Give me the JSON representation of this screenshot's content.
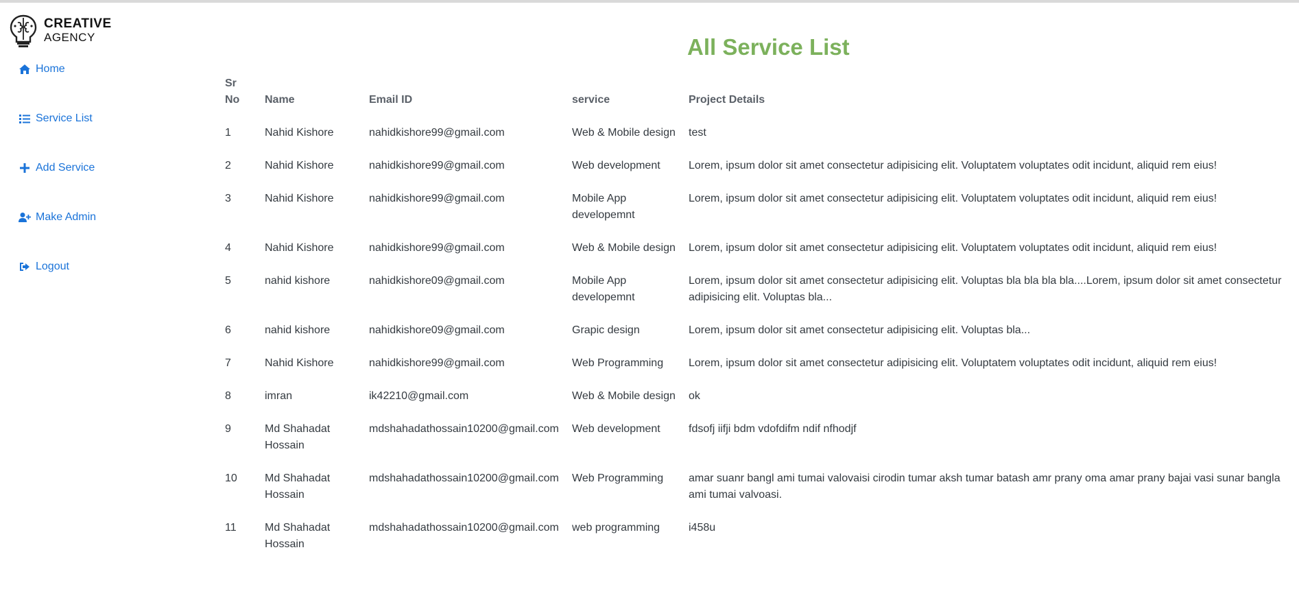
{
  "brand": {
    "line1": "CREATIVE",
    "line2": "AGENCY"
  },
  "sidebar": {
    "items": [
      {
        "label": "Home",
        "icon": "home-icon"
      },
      {
        "label": "Service List",
        "icon": "list-icon"
      },
      {
        "label": "Add Service",
        "icon": "plus-icon"
      },
      {
        "label": "Make Admin",
        "icon": "user-plus-icon"
      },
      {
        "label": "Logout",
        "icon": "logout-icon"
      }
    ]
  },
  "page": {
    "title": "All Service List"
  },
  "table": {
    "headers": {
      "sr": "Sr No",
      "name": "Name",
      "email": "Email ID",
      "service": "service",
      "details": "Project Details"
    },
    "rows": [
      {
        "sr": "1",
        "name": "Nahid Kishore",
        "email": "nahidkishore99@gmail.com",
        "service": "Web & Mobile design",
        "details": "test"
      },
      {
        "sr": "2",
        "name": "Nahid Kishore",
        "email": "nahidkishore99@gmail.com",
        "service": "Web development",
        "details": "Lorem, ipsum dolor sit amet consectetur adipisicing elit. Voluptatem voluptates odit incidunt, aliquid rem eius!"
      },
      {
        "sr": "3",
        "name": "Nahid Kishore",
        "email": "nahidkishore99@gmail.com",
        "service": "Mobile App developemnt",
        "details": "Lorem, ipsum dolor sit amet consectetur adipisicing elit. Voluptatem voluptates odit incidunt, aliquid rem eius!"
      },
      {
        "sr": "4",
        "name": "Nahid Kishore",
        "email": "nahidkishore99@gmail.com",
        "service": "Web & Mobile design",
        "details": "Lorem, ipsum dolor sit amet consectetur adipisicing elit. Voluptatem voluptates odit incidunt, aliquid rem eius!"
      },
      {
        "sr": "5",
        "name": "nahid kishore",
        "email": "nahidkishore09@gmail.com",
        "service": "Mobile App developemnt",
        "details": "Lorem, ipsum dolor sit amet consectetur adipisicing elit. Voluptas bla bla bla bla....Lorem, ipsum dolor sit amet consectetur adipisicing elit. Voluptas bla..."
      },
      {
        "sr": "6",
        "name": "nahid kishore",
        "email": "nahidkishore09@gmail.com",
        "service": "Grapic design",
        "details": "Lorem, ipsum dolor sit amet consectetur adipisicing elit. Voluptas bla..."
      },
      {
        "sr": "7",
        "name": "Nahid Kishore",
        "email": "nahidkishore99@gmail.com",
        "service": "Web Programming",
        "details": "Lorem, ipsum dolor sit amet consectetur adipisicing elit. Voluptatem voluptates odit incidunt, aliquid rem eius!"
      },
      {
        "sr": "8",
        "name": "imran",
        "email": "ik42210@gmail.com",
        "service": "Web & Mobile design",
        "details": "ok"
      },
      {
        "sr": "9",
        "name": "Md Shahadat Hossain",
        "email": "mdshahadathossain10200@gmail.com",
        "service": "Web development",
        "details": "fdsofj iifji bdm vdofdifm ndif nfhodjf"
      },
      {
        "sr": "10",
        "name": "Md Shahadat Hossain",
        "email": "mdshahadathossain10200@gmail.com",
        "service": "Web Programming",
        "details": "amar suanr bangl ami tumai valovaisi cirodin tumar aksh tumar batash amr prany oma amar prany bajai vasi sunar bangla ami tumai valvoasi."
      },
      {
        "sr": "11",
        "name": "Md Shahadat Hossain",
        "email": "mdshahadathossain10200@gmail.com",
        "service": "web programming",
        "details": "i458u"
      }
    ]
  },
  "colors": {
    "accent": "#7cb15c",
    "link": "#1a73d9"
  }
}
